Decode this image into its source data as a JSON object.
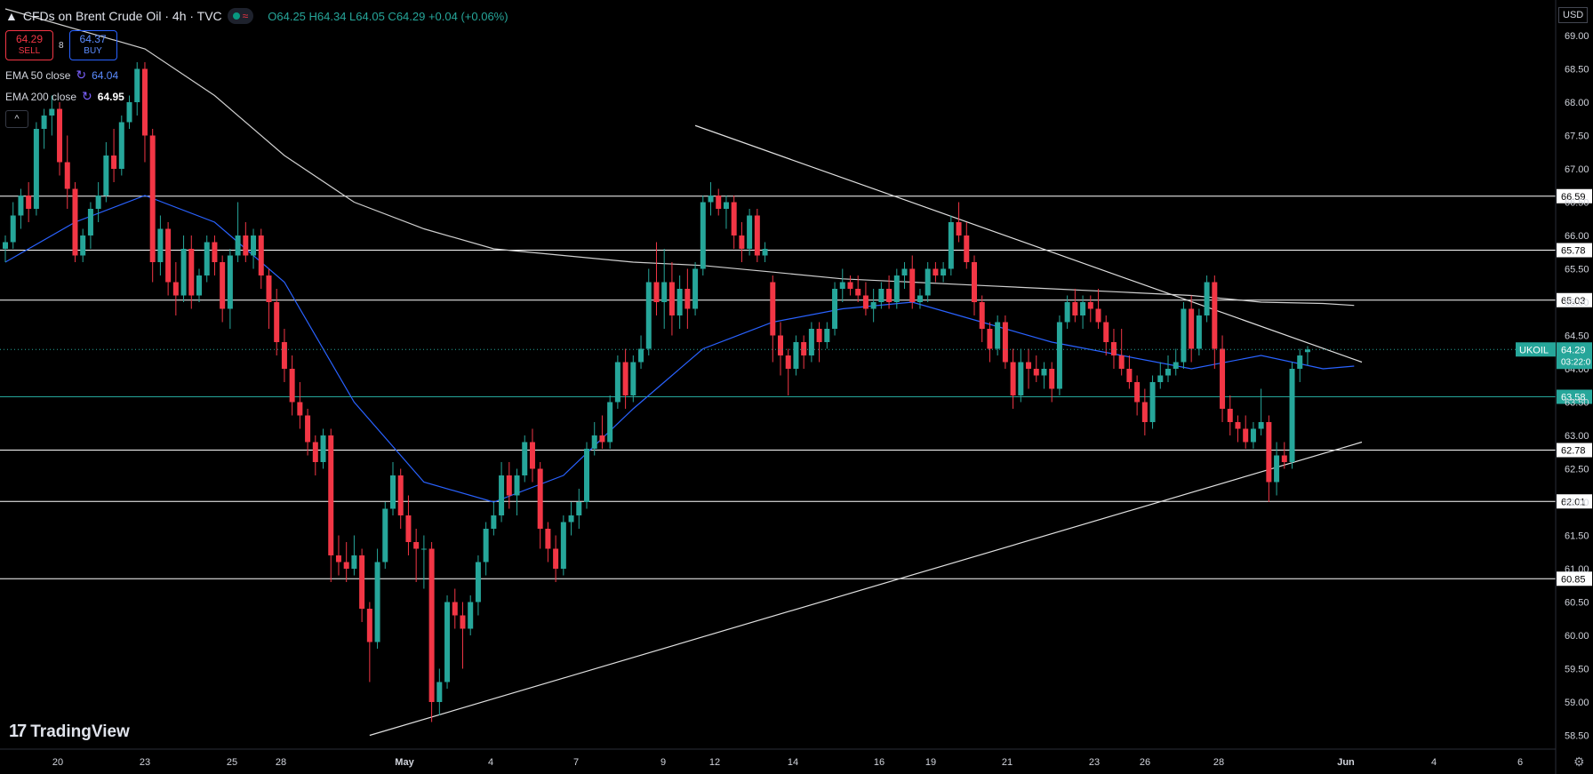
{
  "header": {
    "title": "CFDs on Brent Crude Oil · 4h · TVC",
    "ohlc": "O64.25 H64.34 L64.05 C64.29 +0.04 (+0.06%)"
  },
  "trade": {
    "sell_price": "64.29",
    "sell_label": "SELL",
    "spread": "8",
    "buy_price": "64.37",
    "buy_label": "BUY"
  },
  "legend": {
    "ema50_label": "EMA 50 close",
    "ema50_value": "64.04",
    "ema200_label": "EMA 200 close",
    "ema200_value": "64.95",
    "collapse_glyph": "^"
  },
  "branding": "TradingView",
  "currency": "USD",
  "colors": {
    "up": "#26a69a",
    "down": "#f23645",
    "ema50": "#2962ff",
    "ema200": "#cfcfcf",
    "green_level": "#26a69a"
  },
  "chart_data": {
    "type": "candlestick",
    "symbol": "UKOIL",
    "ylim": [
      58.3,
      69.2
    ],
    "y_ticks": [
      "58.50",
      "59.00",
      "59.50",
      "60.00",
      "60.50",
      "61.00",
      "61.50",
      "62.00",
      "62.50",
      "63.00",
      "63.50",
      "64.00",
      "64.50",
      "65.00",
      "65.50",
      "66.00",
      "66.50",
      "67.00",
      "67.50",
      "68.00",
      "68.50",
      "69.00"
    ],
    "x_ticks": [
      "20",
      "23",
      "25",
      "28",
      "May",
      "4",
      "7",
      "9",
      "12",
      "14",
      "16",
      "19",
      "21",
      "23",
      "26",
      "28",
      "Jun",
      "4",
      "6"
    ],
    "horizontal_levels": [
      {
        "value": 66.59,
        "label": "66.59",
        "color": "#ffffff"
      },
      {
        "value": 65.78,
        "label": "65.78",
        "color": "#ffffff"
      },
      {
        "value": 65.03,
        "label": "65.03",
        "color": "#ffffff"
      },
      {
        "value": 63.58,
        "label": "63.58",
        "color": "#26a69a"
      },
      {
        "value": 62.78,
        "label": "62.78",
        "color": "#ffffff"
      },
      {
        "value": 62.01,
        "label": "62.01",
        "color": "#ffffff"
      },
      {
        "value": 60.85,
        "label": "60.85",
        "color": "#ffffff"
      }
    ],
    "last_price": {
      "label": "UKOIL",
      "value": "64.29",
      "countdown": "03:22:0"
    },
    "trendlines": [
      {
        "name": "resistance",
        "from": {
          "bar": 89,
          "y": 67.65
        },
        "to": {
          "bar": 175,
          "y": 64.1
        }
      },
      {
        "name": "support",
        "from": {
          "bar": 47,
          "y": 58.5
        },
        "to": {
          "bar": 175,
          "y": 62.9
        }
      }
    ],
    "candles": [
      [
        65.8,
        66.0,
        65.6,
        65.9
      ],
      [
        65.9,
        66.5,
        65.8,
        66.3
      ],
      [
        66.3,
        66.7,
        66.1,
        66.6
      ],
      [
        66.6,
        66.8,
        66.2,
        66.4
      ],
      [
        66.4,
        67.7,
        66.3,
        67.6
      ],
      [
        67.6,
        67.9,
        67.3,
        67.8
      ],
      [
        67.8,
        68.1,
        67.5,
        67.9
      ],
      [
        67.9,
        68.0,
        66.9,
        67.1
      ],
      [
        67.1,
        67.5,
        66.4,
        66.7
      ],
      [
        66.7,
        66.8,
        65.6,
        65.7
      ],
      [
        65.7,
        66.1,
        65.6,
        66.0
      ],
      [
        66.0,
        66.5,
        65.8,
        66.4
      ],
      [
        66.4,
        66.8,
        66.2,
        66.6
      ],
      [
        66.6,
        67.4,
        66.5,
        67.2
      ],
      [
        67.2,
        67.6,
        66.8,
        67.0
      ],
      [
        67.0,
        67.8,
        66.9,
        67.7
      ],
      [
        67.7,
        68.1,
        67.6,
        68.0
      ],
      [
        68.0,
        68.6,
        67.8,
        68.5
      ],
      [
        68.5,
        68.6,
        67.1,
        67.5
      ],
      [
        67.5,
        67.6,
        65.3,
        65.6
      ],
      [
        65.6,
        66.3,
        65.4,
        66.1
      ],
      [
        66.1,
        66.2,
        65.1,
        65.3
      ],
      [
        65.3,
        65.6,
        64.8,
        65.1
      ],
      [
        65.1,
        66.0,
        65.0,
        65.8
      ],
      [
        65.8,
        66.0,
        64.9,
        65.1
      ],
      [
        65.1,
        65.5,
        65.0,
        65.4
      ],
      [
        65.4,
        66.0,
        65.3,
        65.9
      ],
      [
        65.9,
        66.0,
        65.4,
        65.6
      ],
      [
        65.6,
        65.7,
        64.7,
        64.9
      ],
      [
        64.9,
        65.8,
        64.6,
        65.7
      ],
      [
        65.7,
        66.5,
        65.6,
        66.0
      ],
      [
        66.0,
        66.2,
        65.6,
        65.7
      ],
      [
        65.7,
        66.1,
        65.5,
        66.0
      ],
      [
        66.0,
        66.1,
        65.2,
        65.4
      ],
      [
        65.4,
        65.5,
        64.6,
        65.0
      ],
      [
        65.0,
        65.2,
        64.2,
        64.4
      ],
      [
        64.4,
        64.6,
        63.8,
        64.0
      ],
      [
        64.0,
        64.2,
        63.3,
        63.5
      ],
      [
        63.5,
        63.8,
        63.1,
        63.3
      ],
      [
        63.3,
        63.4,
        62.7,
        62.9
      ],
      [
        62.9,
        63.0,
        62.4,
        62.6
      ],
      [
        62.6,
        63.1,
        62.5,
        63.0
      ],
      [
        63.0,
        63.1,
        60.8,
        61.2
      ],
      [
        61.2,
        61.5,
        60.9,
        61.1
      ],
      [
        61.1,
        61.4,
        60.8,
        61.0
      ],
      [
        61.0,
        61.5,
        60.9,
        61.2
      ],
      [
        61.2,
        61.3,
        60.2,
        60.4
      ],
      [
        60.4,
        60.5,
        59.3,
        59.9
      ],
      [
        59.9,
        61.3,
        59.8,
        61.1
      ],
      [
        61.1,
        62.0,
        61.0,
        61.9
      ],
      [
        61.9,
        62.6,
        61.8,
        62.4
      ],
      [
        62.4,
        62.5,
        61.6,
        61.8
      ],
      [
        61.8,
        62.1,
        61.2,
        61.4
      ],
      [
        61.4,
        61.6,
        60.8,
        61.3
      ],
      [
        61.3,
        61.5,
        60.7,
        61.3
      ],
      [
        61.3,
        61.4,
        58.7,
        59.0
      ],
      [
        59.0,
        59.5,
        58.8,
        59.3
      ],
      [
        59.3,
        60.6,
        59.2,
        60.5
      ],
      [
        60.5,
        60.7,
        60.1,
        60.3
      ],
      [
        60.3,
        60.5,
        59.5,
        60.1
      ],
      [
        60.1,
        60.6,
        60.0,
        60.5
      ],
      [
        60.5,
        61.2,
        60.3,
        61.1
      ],
      [
        61.1,
        61.7,
        60.9,
        61.6
      ],
      [
        61.6,
        62.0,
        61.5,
        61.8
      ],
      [
        61.8,
        62.6,
        61.7,
        62.4
      ],
      [
        62.4,
        62.6,
        61.9,
        62.1
      ],
      [
        62.1,
        62.5,
        61.8,
        62.4
      ],
      [
        62.4,
        63.0,
        62.3,
        62.9
      ],
      [
        62.9,
        63.1,
        62.3,
        62.5
      ],
      [
        62.5,
        62.6,
        61.3,
        61.6
      ],
      [
        61.6,
        61.7,
        61.1,
        61.3
      ],
      [
        61.3,
        61.5,
        60.8,
        61.0
      ],
      [
        61.0,
        61.8,
        60.9,
        61.7
      ],
      [
        61.7,
        62.0,
        61.5,
        61.8
      ],
      [
        61.8,
        62.2,
        61.6,
        62.0
      ],
      [
        62.0,
        62.9,
        61.9,
        62.8
      ],
      [
        62.8,
        63.2,
        62.7,
        63.0
      ],
      [
        63.0,
        63.3,
        62.8,
        62.9
      ],
      [
        62.9,
        63.6,
        62.8,
        63.5
      ],
      [
        63.5,
        64.2,
        63.4,
        64.1
      ],
      [
        64.1,
        64.3,
        63.4,
        63.6
      ],
      [
        63.6,
        64.2,
        63.5,
        64.1
      ],
      [
        64.1,
        64.5,
        64.0,
        64.3
      ],
      [
        64.3,
        65.5,
        64.2,
        65.3
      ],
      [
        65.3,
        65.9,
        64.8,
        65.0
      ],
      [
        65.0,
        65.8,
        64.6,
        65.3
      ],
      [
        65.3,
        65.6,
        64.5,
        64.8
      ],
      [
        64.8,
        65.4,
        64.6,
        65.2
      ],
      [
        65.2,
        65.5,
        64.6,
        64.9
      ],
      [
        64.9,
        65.6,
        64.8,
        65.5
      ],
      [
        65.5,
        66.6,
        65.4,
        66.5
      ],
      [
        66.5,
        66.8,
        66.3,
        66.6
      ],
      [
        66.6,
        66.7,
        66.3,
        66.4
      ],
      [
        66.4,
        66.6,
        66.1,
        66.5
      ],
      [
        66.5,
        66.6,
        65.8,
        66.0
      ],
      [
        66.0,
        66.2,
        65.6,
        65.8
      ],
      [
        65.8,
        66.4,
        65.7,
        66.3
      ],
      [
        66.3,
        66.4,
        65.6,
        65.7
      ],
      [
        65.7,
        65.9,
        65.6,
        65.8
      ],
      [
        65.3,
        65.4,
        64.1,
        64.5
      ],
      [
        64.5,
        64.7,
        63.9,
        64.2
      ],
      [
        64.2,
        64.3,
        63.6,
        64.0
      ],
      [
        64.0,
        64.5,
        63.9,
        64.4
      ],
      [
        64.4,
        64.5,
        64.0,
        64.2
      ],
      [
        64.2,
        64.7,
        64.1,
        64.6
      ],
      [
        64.6,
        64.7,
        64.1,
        64.4
      ],
      [
        64.4,
        64.7,
        64.3,
        64.6
      ],
      [
        64.6,
        65.3,
        64.5,
        65.2
      ],
      [
        65.2,
        65.5,
        65.0,
        65.3
      ],
      [
        65.3,
        65.4,
        65.1,
        65.2
      ],
      [
        65.2,
        65.4,
        65.0,
        65.1
      ],
      [
        65.1,
        65.3,
        64.8,
        64.9
      ],
      [
        64.9,
        65.2,
        64.7,
        65.0
      ],
      [
        65.0,
        65.3,
        64.9,
        65.2
      ],
      [
        65.2,
        65.4,
        64.9,
        65.0
      ],
      [
        65.0,
        65.5,
        64.9,
        65.4
      ],
      [
        65.4,
        65.6,
        65.2,
        65.5
      ],
      [
        65.5,
        65.7,
        64.9,
        65.0
      ],
      [
        65.0,
        65.2,
        64.9,
        65.1
      ],
      [
        65.1,
        65.6,
        65.0,
        65.5
      ],
      [
        65.5,
        65.6,
        65.3,
        65.4
      ],
      [
        65.4,
        65.6,
        65.3,
        65.5
      ],
      [
        65.5,
        66.3,
        65.4,
        66.2
      ],
      [
        66.2,
        66.5,
        65.9,
        66.0
      ],
      [
        66.0,
        66.2,
        65.5,
        65.6
      ],
      [
        65.6,
        65.7,
        64.8,
        65.0
      ],
      [
        65.0,
        65.1,
        64.4,
        64.6
      ],
      [
        64.6,
        64.7,
        64.1,
        64.3
      ],
      [
        64.3,
        64.8,
        64.2,
        64.7
      ],
      [
        64.7,
        64.8,
        64.0,
        64.1
      ],
      [
        64.1,
        64.3,
        63.4,
        63.6
      ],
      [
        63.6,
        64.3,
        63.5,
        64.1
      ],
      [
        64.1,
        64.3,
        63.7,
        64.0
      ],
      [
        64.0,
        64.2,
        63.8,
        63.9
      ],
      [
        63.9,
        64.1,
        63.7,
        64.0
      ],
      [
        64.0,
        64.1,
        63.5,
        63.7
      ],
      [
        63.7,
        64.8,
        63.6,
        64.7
      ],
      [
        64.7,
        65.1,
        64.6,
        65.0
      ],
      [
        65.0,
        65.2,
        64.7,
        64.8
      ],
      [
        64.8,
        65.1,
        64.6,
        65.0
      ],
      [
        65.0,
        65.1,
        64.7,
        64.9
      ],
      [
        64.9,
        65.2,
        64.6,
        64.7
      ],
      [
        64.7,
        64.8,
        64.2,
        64.4
      ],
      [
        64.4,
        64.6,
        64.0,
        64.2
      ],
      [
        64.2,
        64.6,
        63.9,
        64.0
      ],
      [
        64.0,
        64.2,
        63.7,
        63.8
      ],
      [
        63.8,
        63.9,
        63.3,
        63.5
      ],
      [
        63.5,
        63.7,
        63.0,
        63.2
      ],
      [
        63.2,
        63.9,
        63.1,
        63.8
      ],
      [
        63.8,
        64.1,
        63.7,
        63.9
      ],
      [
        63.9,
        64.2,
        63.8,
        64.0
      ],
      [
        64.0,
        64.3,
        63.9,
        64.1
      ],
      [
        64.1,
        65.0,
        64.0,
        64.9
      ],
      [
        64.9,
        65.1,
        64.1,
        64.3
      ],
      [
        64.3,
        64.9,
        64.2,
        64.8
      ],
      [
        64.8,
        65.4,
        64.7,
        65.3
      ],
      [
        65.3,
        65.4,
        64.0,
        64.3
      ],
      [
        64.3,
        64.5,
        63.2,
        63.4
      ],
      [
        63.4,
        63.6,
        63.0,
        63.2
      ],
      [
        63.2,
        63.3,
        62.9,
        63.1
      ],
      [
        63.1,
        63.3,
        62.8,
        62.9
      ],
      [
        62.9,
        63.2,
        62.8,
        63.1
      ],
      [
        63.1,
        63.7,
        63.0,
        63.2
      ],
      [
        63.2,
        63.3,
        62.0,
        62.3
      ],
      [
        62.3,
        62.9,
        62.1,
        62.7
      ],
      [
        62.7,
        62.9,
        62.5,
        62.6
      ],
      [
        62.6,
        64.1,
        62.5,
        64.0
      ],
      [
        64.0,
        64.3,
        63.8,
        64.2
      ],
      [
        64.25,
        64.34,
        64.05,
        64.29
      ]
    ],
    "ema50": [
      [
        0,
        65.6
      ],
      [
        9,
        66.2
      ],
      [
        18,
        66.6
      ],
      [
        27,
        66.2
      ],
      [
        36,
        65.3
      ],
      [
        45,
        63.5
      ],
      [
        54,
        62.3
      ],
      [
        63,
        62.0
      ],
      [
        72,
        62.4
      ],
      [
        81,
        63.4
      ],
      [
        90,
        64.3
      ],
      [
        99,
        64.7
      ],
      [
        108,
        64.9
      ],
      [
        117,
        65.0
      ],
      [
        126,
        64.7
      ],
      [
        135,
        64.4
      ],
      [
        144,
        64.2
      ],
      [
        153,
        64.0
      ],
      [
        162,
        64.2
      ],
      [
        170,
        64.0
      ],
      [
        174,
        64.04
      ]
    ],
    "ema200": [
      [
        0,
        69.4
      ],
      [
        18,
        68.8
      ],
      [
        27,
        68.1
      ],
      [
        36,
        67.2
      ],
      [
        45,
        66.5
      ],
      [
        54,
        66.1
      ],
      [
        63,
        65.8
      ],
      [
        72,
        65.7
      ],
      [
        81,
        65.6
      ],
      [
        90,
        65.55
      ],
      [
        99,
        65.45
      ],
      [
        108,
        65.35
      ],
      [
        117,
        65.3
      ],
      [
        126,
        65.25
      ],
      [
        135,
        65.2
      ],
      [
        144,
        65.15
      ],
      [
        153,
        65.1
      ],
      [
        162,
        65.0
      ],
      [
        170,
        64.98
      ],
      [
        174,
        64.95
      ]
    ]
  }
}
